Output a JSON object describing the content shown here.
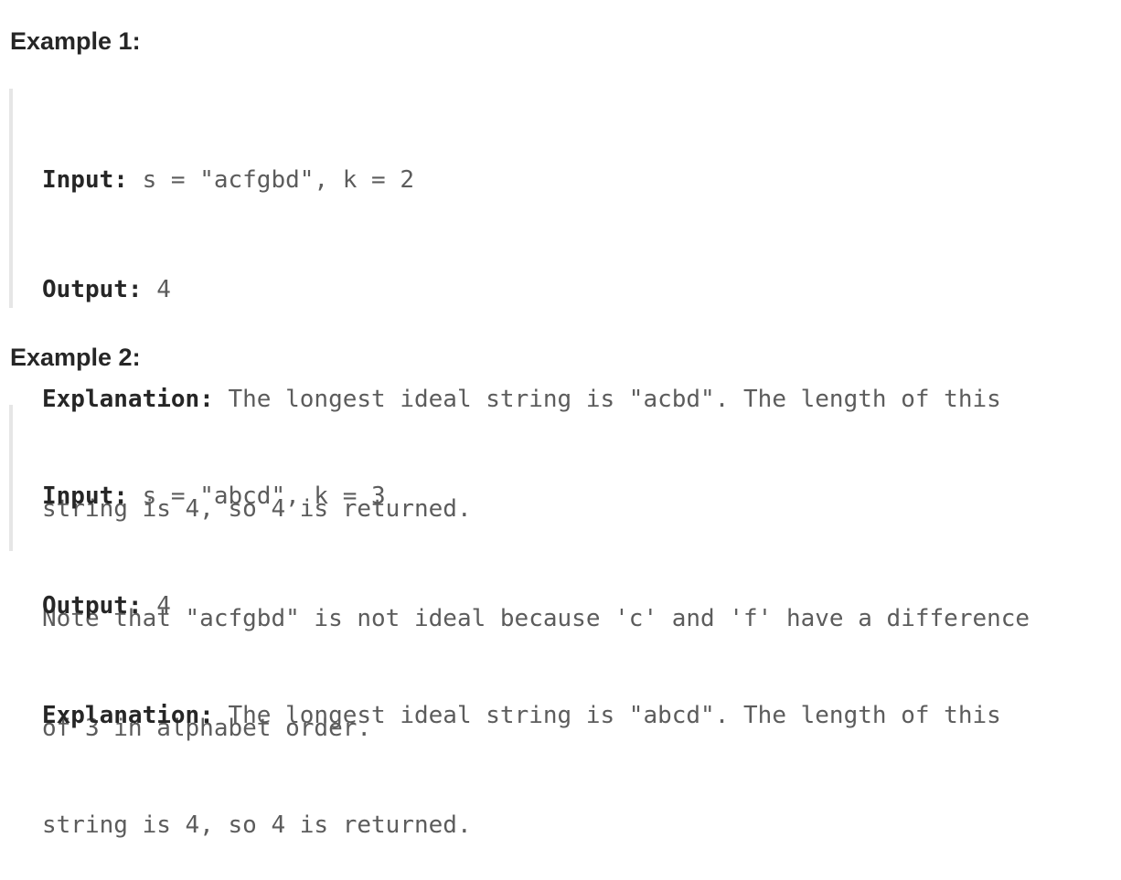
{
  "examples": [
    {
      "heading": "Example 1:",
      "input_label": "Input:",
      "input_value": " s = \"acfgbd\", k = 2",
      "output_label": "Output:",
      "output_value": " 4",
      "explanation_label": "Explanation:",
      "explanation_lines": [
        " The longest ideal string is \"acbd\". The length of this",
        "string is 4, so 4 is returned.",
        "Note that \"acfgbd\" is not ideal because 'c' and 'f' have a difference",
        "of 3 in alphabet order."
      ]
    },
    {
      "heading": "Example 2:",
      "input_label": "Input:",
      "input_value": " s = \"abcd\", k = 3",
      "output_label": "Output:",
      "output_value": " 4",
      "explanation_label": "Explanation:",
      "explanation_lines": [
        " The longest ideal string is \"abcd\". The length of this",
        "string is 4, so 4 is returned."
      ]
    }
  ]
}
